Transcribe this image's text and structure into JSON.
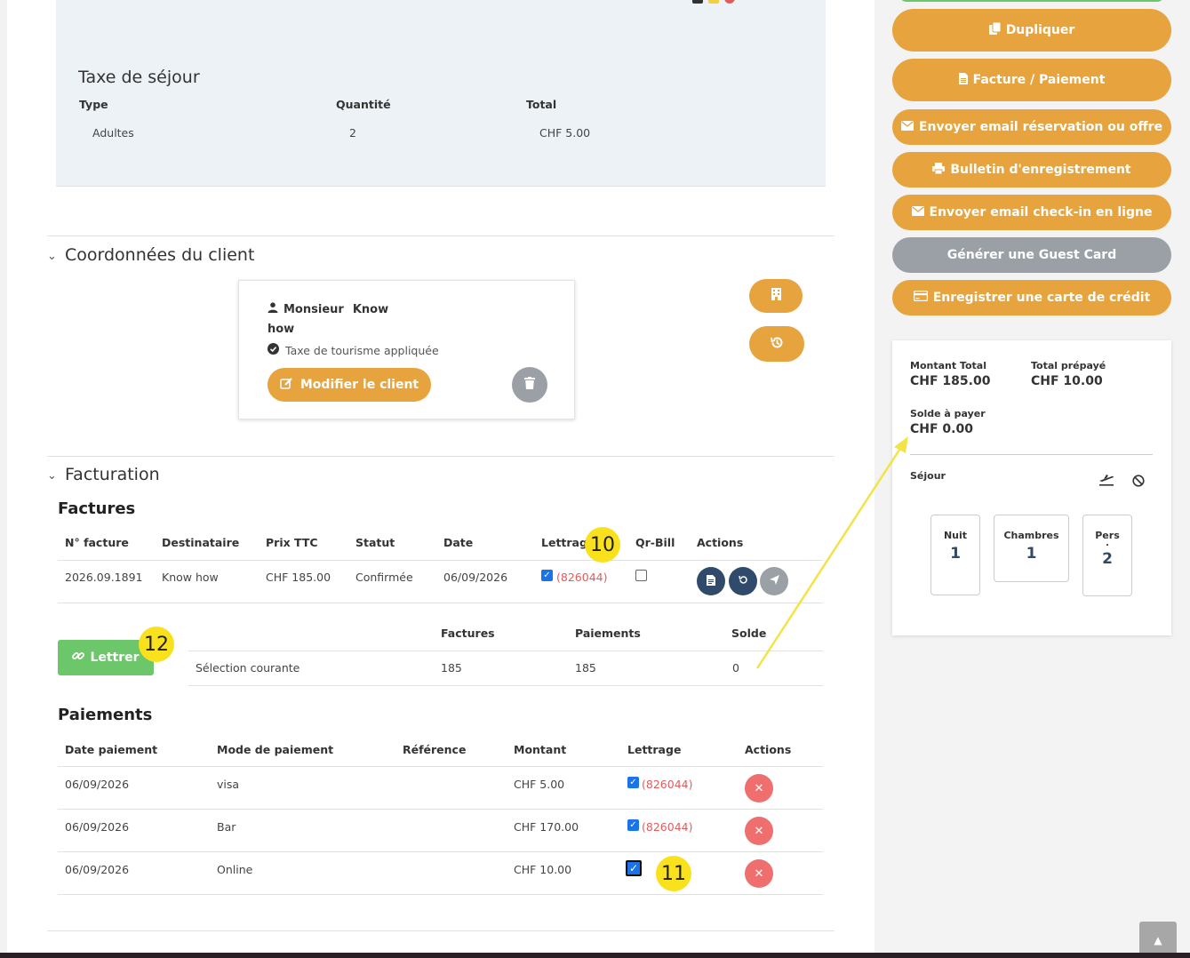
{
  "taxe": {
    "title": "Taxe de séjour",
    "headers": [
      "Type",
      "Quantité",
      "Total"
    ],
    "row": [
      "Adultes",
      "2",
      "CHF 5.00"
    ]
  },
  "client": {
    "section_title": "Coordonnées du client",
    "salutation": "Monsieur",
    "first_name": "Know",
    "last_name": "how",
    "tax_note": "Taxe de tourisme appliquée",
    "edit_label": "Modifier le client"
  },
  "billing": {
    "section_title": "Facturation",
    "invoices_title": "Factures",
    "invoice_headers": [
      "N° facture",
      "Destinataire",
      "Prix TTC",
      "Statut",
      "Date",
      "Lettrag",
      "Qr-Bill",
      "Actions"
    ],
    "invoice_row": {
      "number": "2026.09.1891",
      "recipient": "Know how",
      "price": "CHF 185.00",
      "status": "Confirmée",
      "date": "06/09/2026",
      "lettrage": "(826044)"
    },
    "lettrer_label": "Lettrer",
    "selection_headers": [
      "Factures",
      "Paiements",
      "Solde"
    ],
    "selection_row": [
      "Sélection courante",
      "185",
      "185",
      "0"
    ],
    "payments_title": "Paiements",
    "payment_headers": [
      "Date paiement",
      "Mode de paiement",
      "Référence",
      "Montant",
      "Lettrage",
      "Actions"
    ],
    "payments": [
      {
        "date": "06/09/2026",
        "mode": "visa",
        "ref": "",
        "amount": "CHF 5.00",
        "lettrage": "(826044)"
      },
      {
        "date": "06/09/2026",
        "mode": "Bar",
        "ref": "",
        "amount": "CHF 170.00",
        "lettrage": "(826044)"
      },
      {
        "date": "06/09/2026",
        "mode": "Online",
        "ref": "",
        "amount": "CHF 10.00",
        "lettrage": ""
      }
    ]
  },
  "badges": {
    "b10": "10",
    "b11": "11",
    "b12": "12"
  },
  "sidebar": {
    "buttons": [
      "Dupliquer",
      "Facture / Paiement",
      "Envoyer email réservation ou offre",
      "Bulletin d'enregistrement",
      "Envoyer email check-in en ligne",
      "Générer une Guest Card",
      "Enregistrer une carte de crédit"
    ]
  },
  "summary": {
    "total_label": "Montant Total",
    "total_value": "CHF 185.00",
    "prepaid_label": "Total prépayé",
    "prepaid_value": "CHF 10.00",
    "balance_label": "Solde à payer",
    "balance_value": "CHF 0.00",
    "stay_label": "Séjour",
    "nights_label": "Nuit",
    "nights_value": "1",
    "rooms_label": "Chambres",
    "rooms_value": "1",
    "pers_label": "Pers",
    "pers_dot": ".",
    "pers_value": "2"
  },
  "colors": {
    "accent": "#e6a33e",
    "grey_btn": "#9aa0a6",
    "green": "#6cc76a",
    "danger": "#ef6f6f",
    "badge": "#f9e11d",
    "navy": "#2f4a6b"
  }
}
